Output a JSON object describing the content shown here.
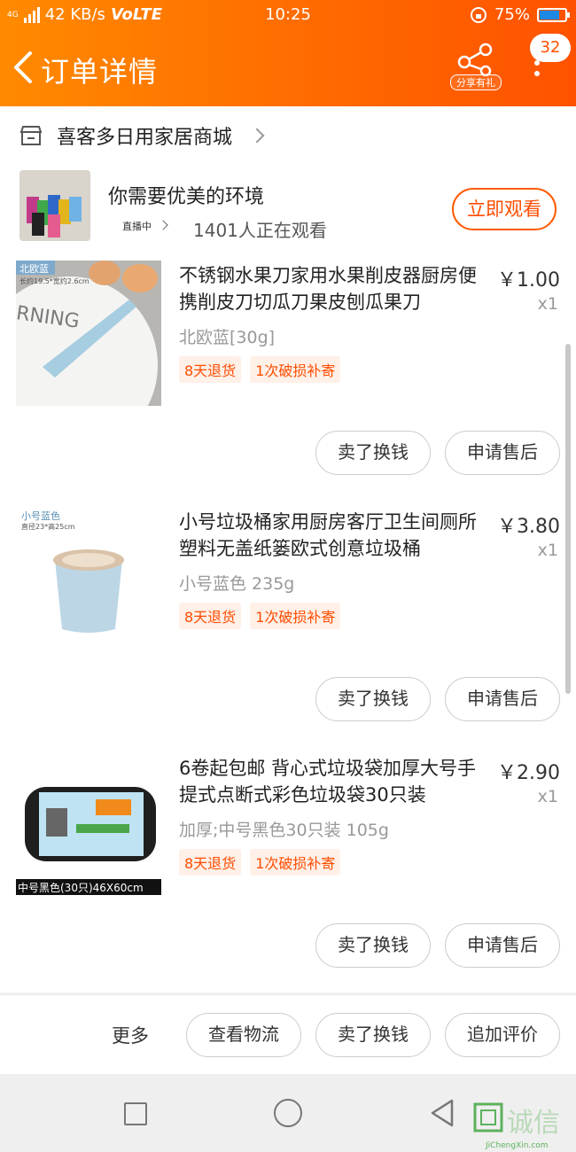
{
  "status_bar": {
    "network": "4G",
    "speed": "42 KB/s",
    "volte": "VoLTE",
    "time": "10:25",
    "battery": "75%"
  },
  "header": {
    "title": "订单详情",
    "share_label": "分享有礼",
    "badge_count": "32"
  },
  "shop": {
    "name": "喜客多日用家居商城"
  },
  "live": {
    "title": "你需要优美的环境",
    "tag": "直播中",
    "viewers": "1401人正在观看",
    "watch_button": "立即观看"
  },
  "items": [
    {
      "name": "不锈钢水果刀家用水果削皮器厨房便携削皮刀切瓜刀果皮刨瓜果刀",
      "price": "￥1.00",
      "qty": "x1",
      "spec": "北欧蓝[30g]",
      "tags": [
        "8天退货",
        "1次破损补寄"
      ],
      "image_label": "北欧蓝",
      "image_sub": "长约19.5*宽约2.6cm",
      "image_word": "RNING",
      "actions": [
        "卖了换钱",
        "申请售后"
      ]
    },
    {
      "name": "小号垃圾桶家用厨房客厅卫生间厕所塑料无盖纸篓欧式创意垃圾桶",
      "price": "￥3.80",
      "qty": "x1",
      "spec": "小号蓝色 235g",
      "tags": [
        "8天退货",
        "1次破损补寄"
      ],
      "image_label": "小号蓝色",
      "image_sub": "直径23*高25cm",
      "actions": [
        "卖了换钱",
        "申请售后"
      ]
    },
    {
      "name": "6卷起包邮 背心式垃圾袋加厚大号手提式点断式彩色垃圾袋30只装",
      "price": "￥2.90",
      "qty": "x1",
      "spec": "加厚;中号黑色30只装 105g",
      "tags": [
        "8天退货",
        "1次破损补寄"
      ],
      "image_caption": "中号黑色(30只)46X60cm",
      "actions": [
        "卖了换钱",
        "申请售后"
      ]
    }
  ],
  "bottom_bar": {
    "more": "更多",
    "buttons": [
      "查看物流",
      "卖了换钱",
      "追加评价"
    ]
  },
  "watermark": {
    "name": "诚信",
    "url": "JiChengXin.com"
  },
  "colors": {
    "accent": "#ff5a00",
    "header_start": "#ff8a00",
    "header_end": "#ff5200",
    "tag_bg": "#fff0e8"
  }
}
